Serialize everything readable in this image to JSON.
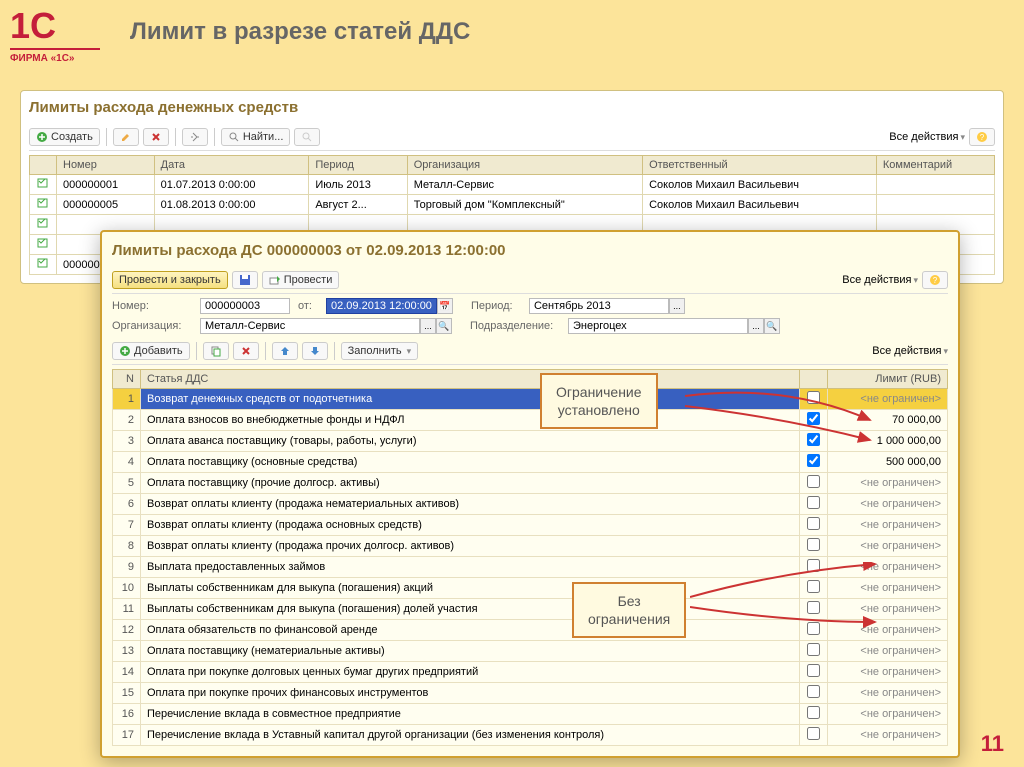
{
  "slide": {
    "title": "Лимит в разрезе статей ДДС",
    "logo_top": "1C",
    "logo_sub": "ФИРМА «1С»",
    "page": "11"
  },
  "panel": {
    "title": "Лимиты расхода денежных средств",
    "toolbar": {
      "create": "Создать",
      "find": "Найти...",
      "all_actions": "Все действия"
    },
    "columns": {
      "number": "Номер",
      "date": "Дата",
      "period": "Период",
      "org": "Организация",
      "resp": "Ответственный",
      "comment": "Комментарий"
    },
    "rows": [
      {
        "num": "000000001",
        "date": "01.07.2013 0:00:00",
        "period": "Июль 2013",
        "org": "Металл-Сервис",
        "resp": "Соколов Михаил Васильевич"
      },
      {
        "num": "000000005",
        "date": "01.08.2013 0:00:00",
        "period": "Август 2...",
        "org": "Торговый дом \"Комплексный\"",
        "resp": "Соколов Михаил Васильевич"
      },
      {
        "num": "",
        "date": "",
        "period": "",
        "org": "",
        "resp": ""
      },
      {
        "num": "",
        "date": "",
        "period": "",
        "org": "",
        "resp": ""
      },
      {
        "num": "0000000",
        "date": "",
        "period": "",
        "org": "",
        "resp": ""
      }
    ]
  },
  "dialog": {
    "title": "Лимиты расхода ДС 000000003 от 02.09.2013 12:00:00",
    "toolbar": {
      "post_close": "Провести и закрыть",
      "post": "Провести",
      "all_actions": "Все действия"
    },
    "form": {
      "number_label": "Номер:",
      "number": "000000003",
      "from_label": "от:",
      "from": "02.09.2013 12:00:00",
      "period_label": "Период:",
      "period": "Сентябрь 2013",
      "org_label": "Организация:",
      "org": "Металл-Сервис",
      "dept_label": "Подразделение:",
      "dept": "Энергоцех"
    },
    "toolbar2": {
      "add": "Добавить",
      "fill": "Заполнить",
      "all_actions": "Все действия"
    },
    "columns": {
      "n": "N",
      "article": "Статья ДДС",
      "chk": "",
      "limit": "Лимит (RUB)"
    },
    "rows": [
      {
        "n": "1",
        "article": "Возврат денежных средств от подотчетника",
        "chk": false,
        "limit": "<не ограничен>"
      },
      {
        "n": "2",
        "article": "Оплата взносов во внебюджетные фонды и НДФЛ",
        "chk": true,
        "limit": "70 000,00"
      },
      {
        "n": "3",
        "article": "Оплата аванса поставщику (товары, работы, услуги)",
        "chk": true,
        "limit": "1 000 000,00"
      },
      {
        "n": "4",
        "article": "Оплата поставщику (основные средства)",
        "chk": true,
        "limit": "500 000,00"
      },
      {
        "n": "5",
        "article": "Оплата поставщику (прочие долгоср. активы)",
        "chk": false,
        "limit": "<не ограничен>"
      },
      {
        "n": "6",
        "article": "Возврат оплаты клиенту (продажа нематериальных активов)",
        "chk": false,
        "limit": "<не ограничен>"
      },
      {
        "n": "7",
        "article": "Возврат оплаты клиенту (продажа основных средств)",
        "chk": false,
        "limit": "<не ограничен>"
      },
      {
        "n": "8",
        "article": "Возврат оплаты клиенту (продажа прочих долгоср. активов)",
        "chk": false,
        "limit": "<не ограничен>"
      },
      {
        "n": "9",
        "article": "Выплата предоставленных займов",
        "chk": false,
        "limit": "<не ограничен>"
      },
      {
        "n": "10",
        "article": "Выплаты собственникам для выкупа (погашения) акций",
        "chk": false,
        "limit": "<не ограничен>"
      },
      {
        "n": "11",
        "article": "Выплаты собственникам для выкупа (погашения) долей участия",
        "chk": false,
        "limit": "<не ограничен>"
      },
      {
        "n": "12",
        "article": "Оплата обязательств по финансовой аренде",
        "chk": false,
        "limit": "<не ограничен>"
      },
      {
        "n": "13",
        "article": "Оплата поставщику (нематериальные активы)",
        "chk": false,
        "limit": "<не ограничен>"
      },
      {
        "n": "14",
        "article": "Оплата при покупке долговых ценных бумаг других предприятий",
        "chk": false,
        "limit": "<не ограничен>"
      },
      {
        "n": "15",
        "article": "Оплата при покупке прочих финансовых инструментов",
        "chk": false,
        "limit": "<не ограничен>"
      },
      {
        "n": "16",
        "article": "Перечисление вклада в совместное предприятие",
        "chk": false,
        "limit": "<не ограничен>"
      },
      {
        "n": "17",
        "article": "Перечисление вклада в Уставный капитал другой организации (без изменения контроля)",
        "chk": false,
        "limit": "<не ограничен>"
      }
    ]
  },
  "callouts": {
    "set": "Ограничение\nустановлено",
    "none": "Без\nограничения"
  }
}
